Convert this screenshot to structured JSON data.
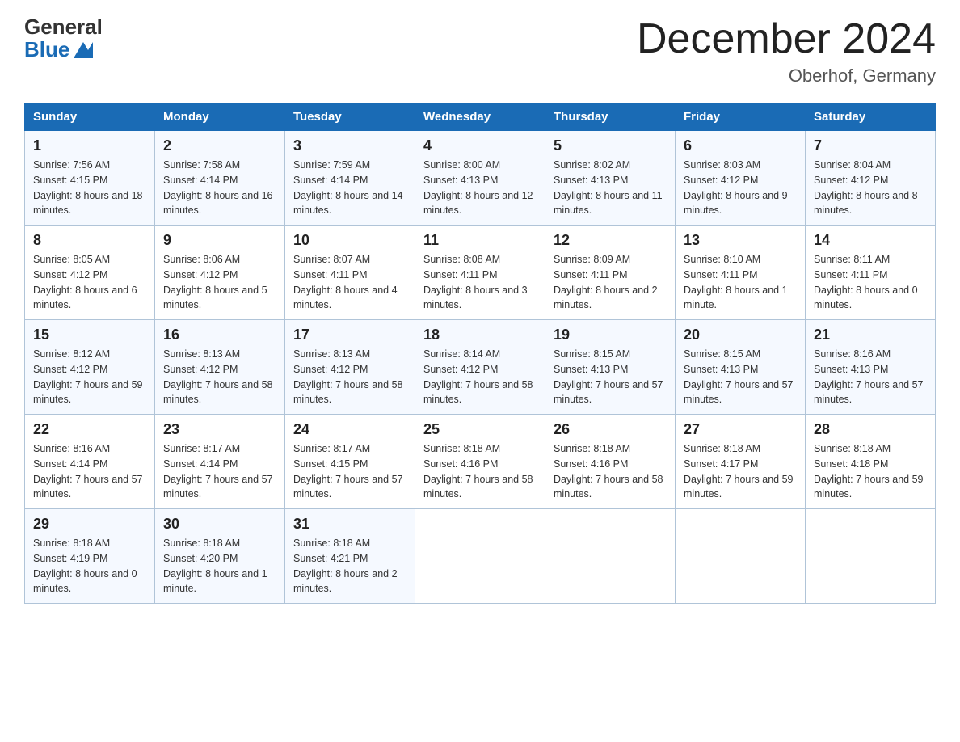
{
  "header": {
    "logo_general": "General",
    "logo_blue": "Blue",
    "title": "December 2024",
    "location": "Oberhof, Germany"
  },
  "columns": [
    "Sunday",
    "Monday",
    "Tuesday",
    "Wednesday",
    "Thursday",
    "Friday",
    "Saturday"
  ],
  "weeks": [
    [
      {
        "day": "1",
        "sunrise": "7:56 AM",
        "sunset": "4:15 PM",
        "daylight": "8 hours and 18 minutes."
      },
      {
        "day": "2",
        "sunrise": "7:58 AM",
        "sunset": "4:14 PM",
        "daylight": "8 hours and 16 minutes."
      },
      {
        "day": "3",
        "sunrise": "7:59 AM",
        "sunset": "4:14 PM",
        "daylight": "8 hours and 14 minutes."
      },
      {
        "day": "4",
        "sunrise": "8:00 AM",
        "sunset": "4:13 PM",
        "daylight": "8 hours and 12 minutes."
      },
      {
        "day": "5",
        "sunrise": "8:02 AM",
        "sunset": "4:13 PM",
        "daylight": "8 hours and 11 minutes."
      },
      {
        "day": "6",
        "sunrise": "8:03 AM",
        "sunset": "4:12 PM",
        "daylight": "8 hours and 9 minutes."
      },
      {
        "day": "7",
        "sunrise": "8:04 AM",
        "sunset": "4:12 PM",
        "daylight": "8 hours and 8 minutes."
      }
    ],
    [
      {
        "day": "8",
        "sunrise": "8:05 AM",
        "sunset": "4:12 PM",
        "daylight": "8 hours and 6 minutes."
      },
      {
        "day": "9",
        "sunrise": "8:06 AM",
        "sunset": "4:12 PM",
        "daylight": "8 hours and 5 minutes."
      },
      {
        "day": "10",
        "sunrise": "8:07 AM",
        "sunset": "4:11 PM",
        "daylight": "8 hours and 4 minutes."
      },
      {
        "day": "11",
        "sunrise": "8:08 AM",
        "sunset": "4:11 PM",
        "daylight": "8 hours and 3 minutes."
      },
      {
        "day": "12",
        "sunrise": "8:09 AM",
        "sunset": "4:11 PM",
        "daylight": "8 hours and 2 minutes."
      },
      {
        "day": "13",
        "sunrise": "8:10 AM",
        "sunset": "4:11 PM",
        "daylight": "8 hours and 1 minute."
      },
      {
        "day": "14",
        "sunrise": "8:11 AM",
        "sunset": "4:11 PM",
        "daylight": "8 hours and 0 minutes."
      }
    ],
    [
      {
        "day": "15",
        "sunrise": "8:12 AM",
        "sunset": "4:12 PM",
        "daylight": "7 hours and 59 minutes."
      },
      {
        "day": "16",
        "sunrise": "8:13 AM",
        "sunset": "4:12 PM",
        "daylight": "7 hours and 58 minutes."
      },
      {
        "day": "17",
        "sunrise": "8:13 AM",
        "sunset": "4:12 PM",
        "daylight": "7 hours and 58 minutes."
      },
      {
        "day": "18",
        "sunrise": "8:14 AM",
        "sunset": "4:12 PM",
        "daylight": "7 hours and 58 minutes."
      },
      {
        "day": "19",
        "sunrise": "8:15 AM",
        "sunset": "4:13 PM",
        "daylight": "7 hours and 57 minutes."
      },
      {
        "day": "20",
        "sunrise": "8:15 AM",
        "sunset": "4:13 PM",
        "daylight": "7 hours and 57 minutes."
      },
      {
        "day": "21",
        "sunrise": "8:16 AM",
        "sunset": "4:13 PM",
        "daylight": "7 hours and 57 minutes."
      }
    ],
    [
      {
        "day": "22",
        "sunrise": "8:16 AM",
        "sunset": "4:14 PM",
        "daylight": "7 hours and 57 minutes."
      },
      {
        "day": "23",
        "sunrise": "8:17 AM",
        "sunset": "4:14 PM",
        "daylight": "7 hours and 57 minutes."
      },
      {
        "day": "24",
        "sunrise": "8:17 AM",
        "sunset": "4:15 PM",
        "daylight": "7 hours and 57 minutes."
      },
      {
        "day": "25",
        "sunrise": "8:18 AM",
        "sunset": "4:16 PM",
        "daylight": "7 hours and 58 minutes."
      },
      {
        "day": "26",
        "sunrise": "8:18 AM",
        "sunset": "4:16 PM",
        "daylight": "7 hours and 58 minutes."
      },
      {
        "day": "27",
        "sunrise": "8:18 AM",
        "sunset": "4:17 PM",
        "daylight": "7 hours and 59 minutes."
      },
      {
        "day": "28",
        "sunrise": "8:18 AM",
        "sunset": "4:18 PM",
        "daylight": "7 hours and 59 minutes."
      }
    ],
    [
      {
        "day": "29",
        "sunrise": "8:18 AM",
        "sunset": "4:19 PM",
        "daylight": "8 hours and 0 minutes."
      },
      {
        "day": "30",
        "sunrise": "8:18 AM",
        "sunset": "4:20 PM",
        "daylight": "8 hours and 1 minute."
      },
      {
        "day": "31",
        "sunrise": "8:18 AM",
        "sunset": "4:21 PM",
        "daylight": "8 hours and 2 minutes."
      },
      null,
      null,
      null,
      null
    ]
  ]
}
